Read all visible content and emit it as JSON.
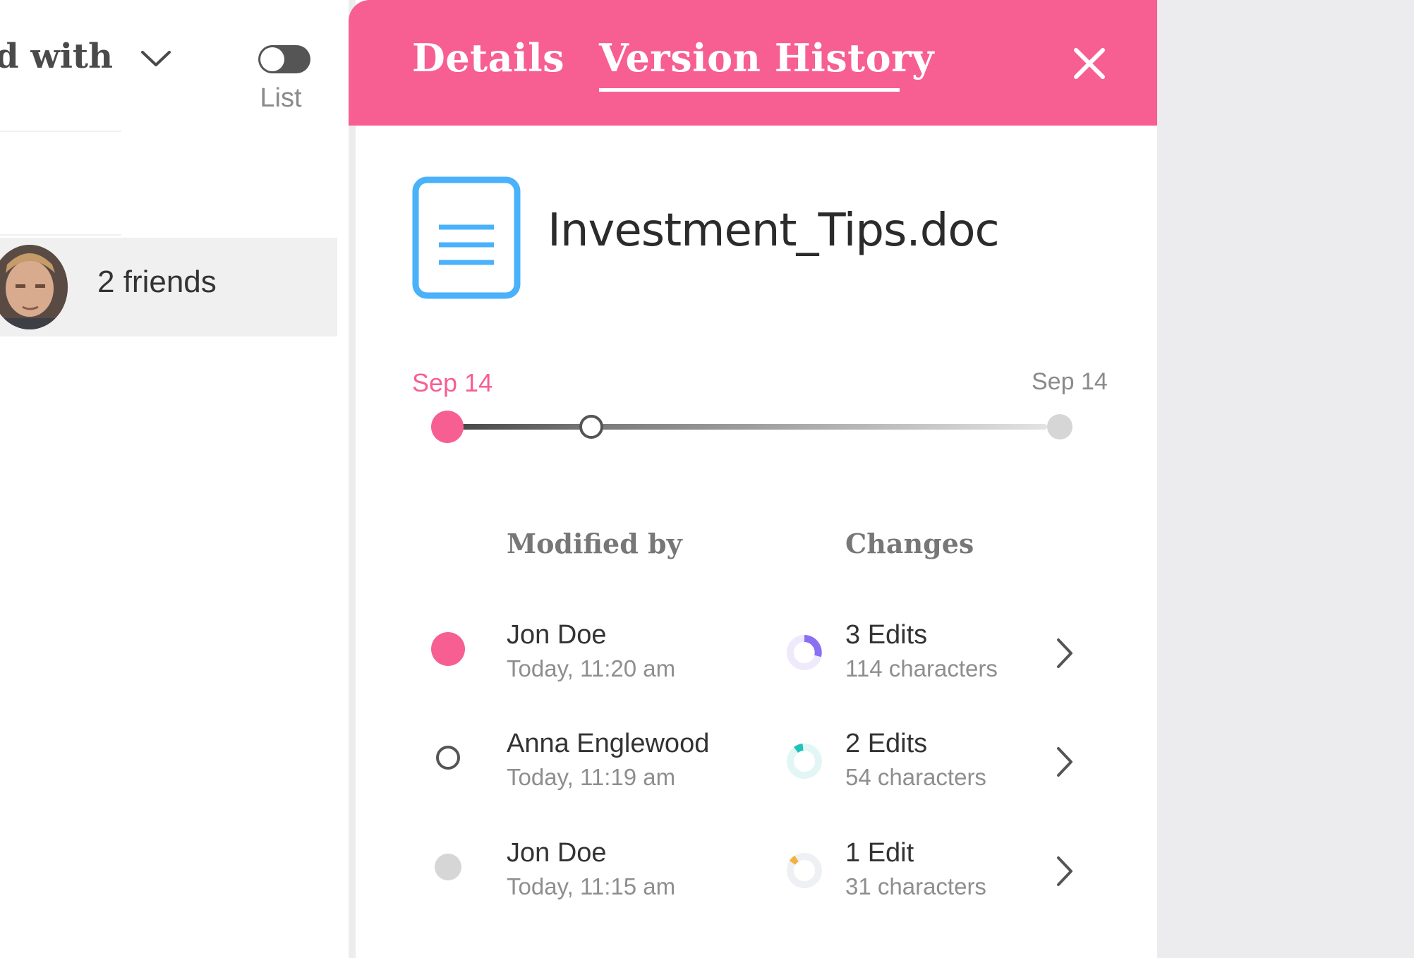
{
  "toolbar": {
    "shared_with_label": "Shared with",
    "view_toggle_label": "List"
  },
  "friends": {
    "label": "2 friends"
  },
  "panel": {
    "tabs": [
      {
        "label": "Details",
        "active": false
      },
      {
        "label": "Version History",
        "active": true
      }
    ],
    "accent_color": "#f75f93",
    "file": {
      "name": "Investment_Tips.doc",
      "icon": "document-icon",
      "icon_color": "#4ab1fb"
    },
    "timeline": {
      "start_label": "Sep 14",
      "end_label": "Sep 14"
    },
    "table": {
      "modified_by_header": "Modified by",
      "changes_header": "Changes",
      "rows": [
        {
          "name": "Jon Doe",
          "time": "Today, 11:20 am",
          "edits": "3 Edits",
          "characters": "114 characters",
          "marker": "filled-pink",
          "donut_color": "#8b6ff2"
        },
        {
          "name": "Anna Englewood",
          "time": "Today, 11:19 am",
          "edits": "2 Edits",
          "characters": "54 characters",
          "marker": "hollow",
          "donut_color": "#1fc3b9"
        },
        {
          "name": "Jon Doe",
          "time": "Today, 11:15 am",
          "edits": "1 Edit",
          "characters": "31 characters",
          "marker": "filled-gray",
          "donut_color": "#f5b13f"
        }
      ]
    }
  }
}
